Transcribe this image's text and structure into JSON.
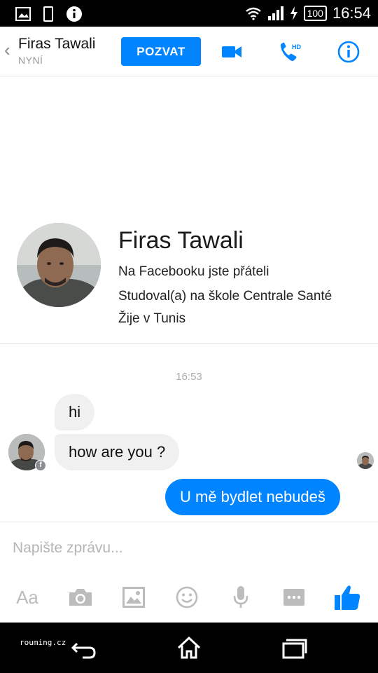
{
  "status_bar": {
    "time": "16:54",
    "battery": "100",
    "icons": [
      "image-icon",
      "phone-outline-icon",
      "info-icon",
      "wifi-icon",
      "signal-icon",
      "charging-icon"
    ]
  },
  "header": {
    "back_icon": "back-chevron-icon",
    "name": "Firas Tawali",
    "status": "NYNÍ",
    "invite_label": "POZVAT",
    "actions": [
      "video-call-icon",
      "hd-call-icon",
      "info-icon"
    ],
    "accent": "#0084ff"
  },
  "profile": {
    "name": "Firas Tawali",
    "lines": [
      "Na Facebooku jste přáteli",
      "Studoval(a) na škole Centrale Santé",
      "Žije v Tunis"
    ]
  },
  "conversation": {
    "timestamp": "16:53",
    "messages": [
      {
        "from": "them",
        "text": "hi"
      },
      {
        "from": "them",
        "text": "how are you ?"
      },
      {
        "from": "me",
        "text": "U mě bydlet nebudeš"
      }
    ]
  },
  "composer": {
    "placeholder": "Napište zprávu...",
    "tools": [
      "text-format-icon",
      "camera-icon",
      "gallery-icon",
      "emoji-icon",
      "microphone-icon",
      "more-icon",
      "thumbs-up-icon"
    ]
  },
  "nav_bar": {
    "watermark": "rouming.cz",
    "buttons": [
      "back-nav-icon",
      "home-nav-icon",
      "recents-nav-icon"
    ]
  }
}
